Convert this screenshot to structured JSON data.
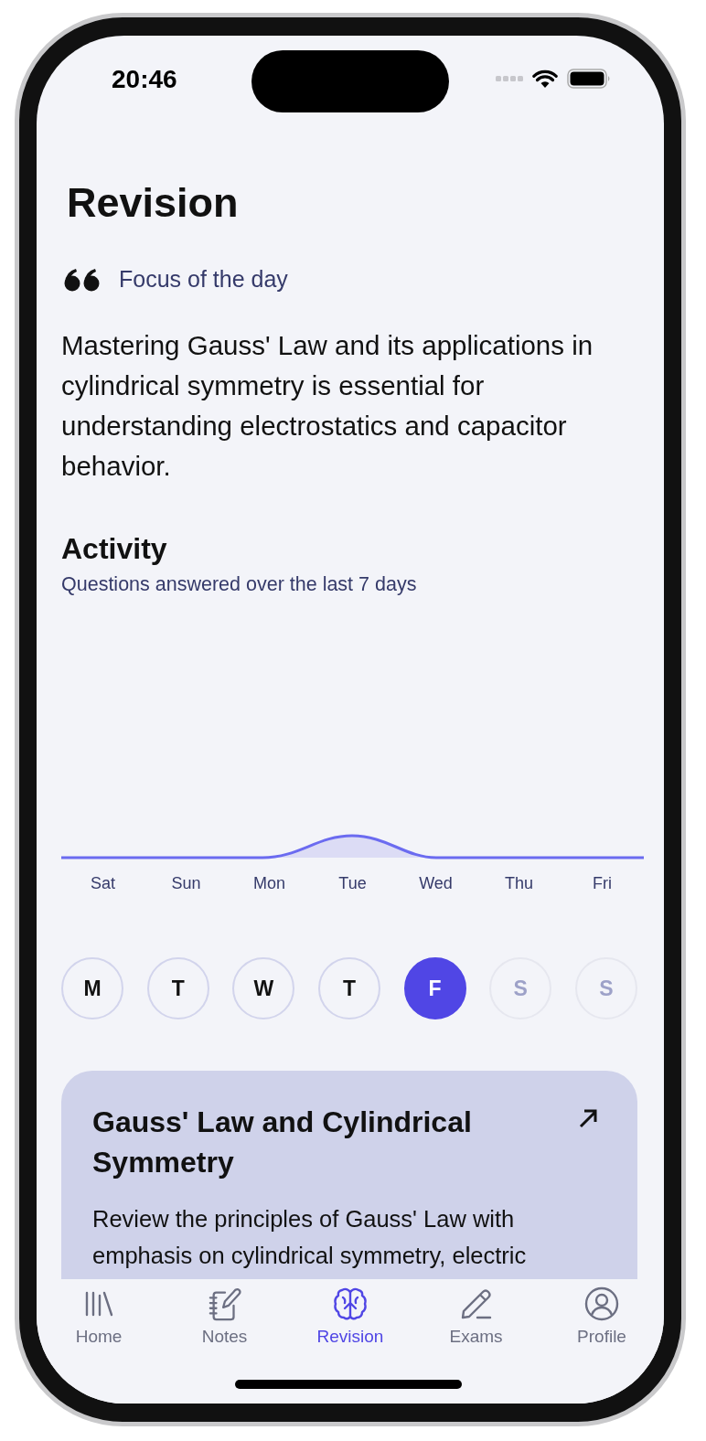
{
  "status_bar": {
    "time": "20:46"
  },
  "header": {
    "title": "Revision"
  },
  "focus": {
    "label": "Focus of the day",
    "text": "Mastering Gauss' Law and its applications in cylindrical symmetry is essential for understanding electrostatics and capacitor behavior."
  },
  "activity": {
    "title": "Activity",
    "subtitle": "Questions answered over the last 7 days",
    "chart": {
      "labels": [
        "Sat",
        "Sun",
        "Mon",
        "Tue",
        "Wed",
        "Thu",
        "Fri"
      ]
    }
  },
  "days": [
    {
      "label": "M",
      "selected": false,
      "disabled": false
    },
    {
      "label": "T",
      "selected": false,
      "disabled": false
    },
    {
      "label": "W",
      "selected": false,
      "disabled": false
    },
    {
      "label": "T",
      "selected": false,
      "disabled": false
    },
    {
      "label": "F",
      "selected": true,
      "disabled": false
    },
    {
      "label": "S",
      "selected": false,
      "disabled": true
    },
    {
      "label": "S",
      "selected": false,
      "disabled": true
    }
  ],
  "card": {
    "title": "Gauss' Law and Cylindrical Symmetry",
    "text": "Review the principles of Gauss' Law with emphasis on cylindrical symmetry, electric"
  },
  "tabs": [
    {
      "kind": "home",
      "label": "Home",
      "selected": false
    },
    {
      "kind": "notes",
      "label": "Notes",
      "selected": false
    },
    {
      "kind": "revision",
      "label": "Revision",
      "selected": true
    },
    {
      "kind": "exams",
      "label": "Exams",
      "selected": false
    },
    {
      "kind": "profile",
      "label": "Profile",
      "selected": false
    }
  ]
}
